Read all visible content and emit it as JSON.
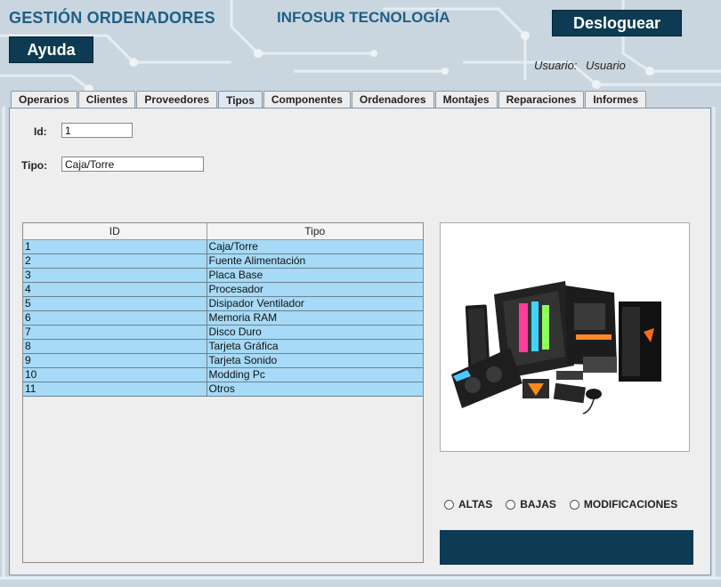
{
  "header": {
    "app_title": "GESTIÓN ORDENADORES",
    "company": "INFOSUR TECNOLOGÍA",
    "logout_label": "Desloguear",
    "help_label": "Ayuda",
    "user_label": "Usuario:",
    "user_value": "Usuario"
  },
  "tabs": [
    {
      "label": "Operarios"
    },
    {
      "label": "Clientes"
    },
    {
      "label": "Proveedores"
    },
    {
      "label": "Tipos"
    },
    {
      "label": "Componentes"
    },
    {
      "label": "Ordenadores"
    },
    {
      "label": "Montajes"
    },
    {
      "label": "Reparaciones"
    },
    {
      "label": "Informes"
    }
  ],
  "active_tab": "Tipos",
  "form": {
    "id_label": "Id:",
    "id_value": "1",
    "tipo_label": "Tipo:",
    "tipo_value": "Caja/Torre"
  },
  "table": {
    "headers": [
      "ID",
      "Tipo"
    ],
    "rows": [
      [
        "1",
        "Caja/Torre"
      ],
      [
        "2",
        "Fuente Alimentación"
      ],
      [
        "3",
        "Placa Base"
      ],
      [
        "4",
        "Procesador"
      ],
      [
        "5",
        "Disipador Ventilador"
      ],
      [
        "6",
        "Memoria RAM"
      ],
      [
        "7",
        "Disco Duro"
      ],
      [
        "8",
        "Tarjeta Gráfica"
      ],
      [
        "9",
        "Tarjeta Sonido"
      ],
      [
        "10",
        "Modding Pc"
      ],
      [
        "11",
        "Otros"
      ]
    ]
  },
  "radios": [
    {
      "label": "ALTAS",
      "selected": false
    },
    {
      "label": "BAJAS",
      "selected": false
    },
    {
      "label": "MODIFICACIONES",
      "selected": false
    }
  ],
  "colors": {
    "title": "#1d5f86",
    "dark_button": "#0d3b53",
    "row_selected": "#a6daf6"
  }
}
